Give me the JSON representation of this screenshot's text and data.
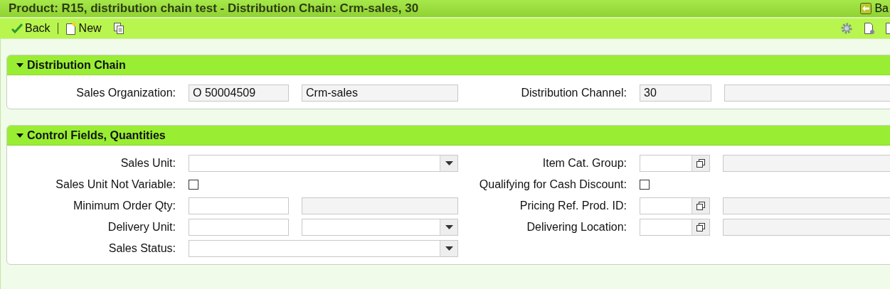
{
  "window": {
    "title": "Product: R15, distribution chain test - Distribution Chain: Crm-sales, 30",
    "back_link": "Ba"
  },
  "toolbar": {
    "buttons": [
      {
        "kind": "back",
        "label": "Back"
      },
      {
        "kind": "new",
        "label": "New"
      },
      {
        "kind": "copy"
      }
    ],
    "right_icons": [
      {
        "kind": "settings"
      },
      {
        "kind": "document"
      },
      {
        "kind": "partial"
      }
    ]
  },
  "sections": [
    {
      "title": "Distribution Chain",
      "expanded": true,
      "rows": [
        {
          "left": {
            "label": "Sales Organization:",
            "fields": [
              {
                "kind": "readonly",
                "value": "O 50004509"
              },
              {
                "kind": "readonly",
                "value": "Crm-sales"
              }
            ]
          },
          "right": {
            "label": "Distribution Channel:",
            "fields": [
              {
                "kind": "readonly",
                "value": "30"
              },
              {
                "kind": "readonly-wide"
              }
            ]
          }
        }
      ]
    },
    {
      "title": "Control Fields, Quantities",
      "expanded": true,
      "rows": [
        {
          "left": {
            "label": "Sales Unit:",
            "fields": [
              {
                "kind": "dropdown-wide"
              }
            ]
          },
          "right": {
            "label": "Item Cat. Group:",
            "fields": [
              {
                "kind": "valuehelp"
              },
              {
                "kind": "readonly-wide"
              }
            ]
          }
        },
        {
          "left": {
            "label": "Sales Unit Not Variable:",
            "fields": [
              {
                "kind": "checkbox",
                "checked": false
              }
            ]
          },
          "right": {
            "label": "Qualifying for Cash Discount:",
            "fields": [
              {
                "kind": "checkbox",
                "checked": false
              }
            ]
          }
        },
        {
          "left": {
            "label": "Minimum Order Qty:",
            "fields": [
              {
                "kind": "text"
              },
              {
                "kind": "readonly"
              }
            ]
          },
          "right": {
            "label": "Pricing Ref. Prod. ID:",
            "fields": [
              {
                "kind": "valuehelp"
              },
              {
                "kind": "readonly-wide"
              }
            ]
          }
        },
        {
          "left": {
            "label": "Delivery Unit:",
            "fields": [
              {
                "kind": "text"
              },
              {
                "kind": "dropdown"
              }
            ]
          },
          "right": {
            "label": "Delivering Location:",
            "fields": [
              {
                "kind": "valuehelp"
              },
              {
                "kind": "readonly-wide"
              }
            ]
          }
        },
        {
          "left": {
            "label": "Sales Status:",
            "fields": [
              {
                "kind": "dropdown-wide"
              }
            ]
          }
        }
      ]
    }
  ]
}
